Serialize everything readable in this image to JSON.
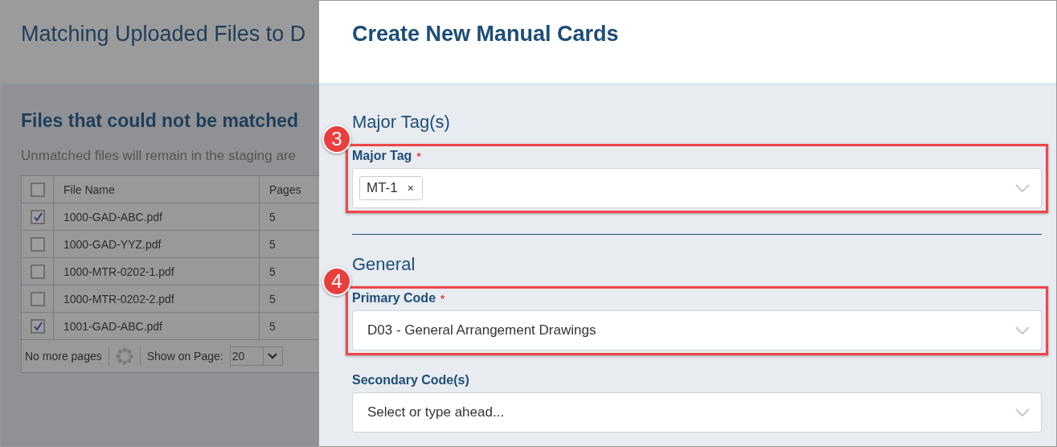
{
  "background_page": {
    "title": "Matching Uploaded Files to D",
    "section_title": "Files that could not be matched",
    "description": "Unmatched files will remain in the staging are",
    "table": {
      "header_checked": false,
      "columns": [
        {
          "label": "File Name"
        },
        {
          "label": "Pages"
        }
      ],
      "rows": [
        {
          "file_name": "1000-GAD-ABC.pdf",
          "pages": "5",
          "checked": true
        },
        {
          "file_name": "1000-GAD-YYZ.pdf",
          "pages": "5",
          "checked": false
        },
        {
          "file_name": "1000-MTR-0202-1.pdf",
          "pages": "5",
          "checked": false
        },
        {
          "file_name": "1000-MTR-0202-2.pdf",
          "pages": "5",
          "checked": false
        },
        {
          "file_name": "1001-GAD-ABC.pdf",
          "pages": "5",
          "checked": true
        }
      ],
      "footer": {
        "status": "No more pages",
        "page_size_label": "Show on Page:",
        "page_size": "20"
      }
    }
  },
  "panel": {
    "title": "Create New Manual Cards",
    "sections": [
      {
        "heading": "Major Tag(s)",
        "fields": [
          {
            "kind": "tags",
            "label": "Major Tag",
            "required_mark": "*",
            "callout": "3",
            "tags": [
              "MT-1"
            ],
            "remove": "×"
          }
        ]
      },
      {
        "heading": "General",
        "fields": [
          {
            "kind": "select",
            "label": "Primary Code",
            "required_mark": "*",
            "callout": "4",
            "value": "D03 - General Arrangement Drawings"
          },
          {
            "kind": "select",
            "label": "Secondary Code(s)",
            "placeholder": "Select or type ahead..."
          }
        ]
      }
    ]
  }
}
